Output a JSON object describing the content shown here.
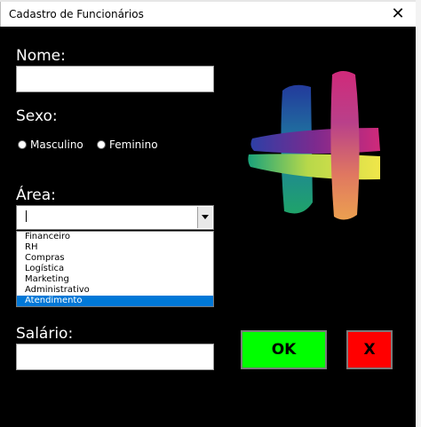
{
  "window": {
    "title": "Cadastro de Funcionários",
    "close_glyph": "✕"
  },
  "form": {
    "nome_label": "Nome:",
    "nome_value": "",
    "sexo_label": "Sexo:",
    "sexo_options": [
      "Masculino",
      "Feminino"
    ],
    "area_label": "Área:",
    "area_value": "",
    "area_options": [
      "Financeiro",
      "RH",
      "Compras",
      "Logística",
      "Marketing",
      "Administrativo",
      "Atendimento"
    ],
    "area_highlighted": "Atendimento",
    "salario_label": "Salário:",
    "salario_value": ""
  },
  "buttons": {
    "ok_label": "OK",
    "cancel_label": "X"
  },
  "colors": {
    "ok": "#00ff00",
    "cancel": "#ff0000",
    "list_highlight": "#0078d7",
    "background": "#000000"
  }
}
